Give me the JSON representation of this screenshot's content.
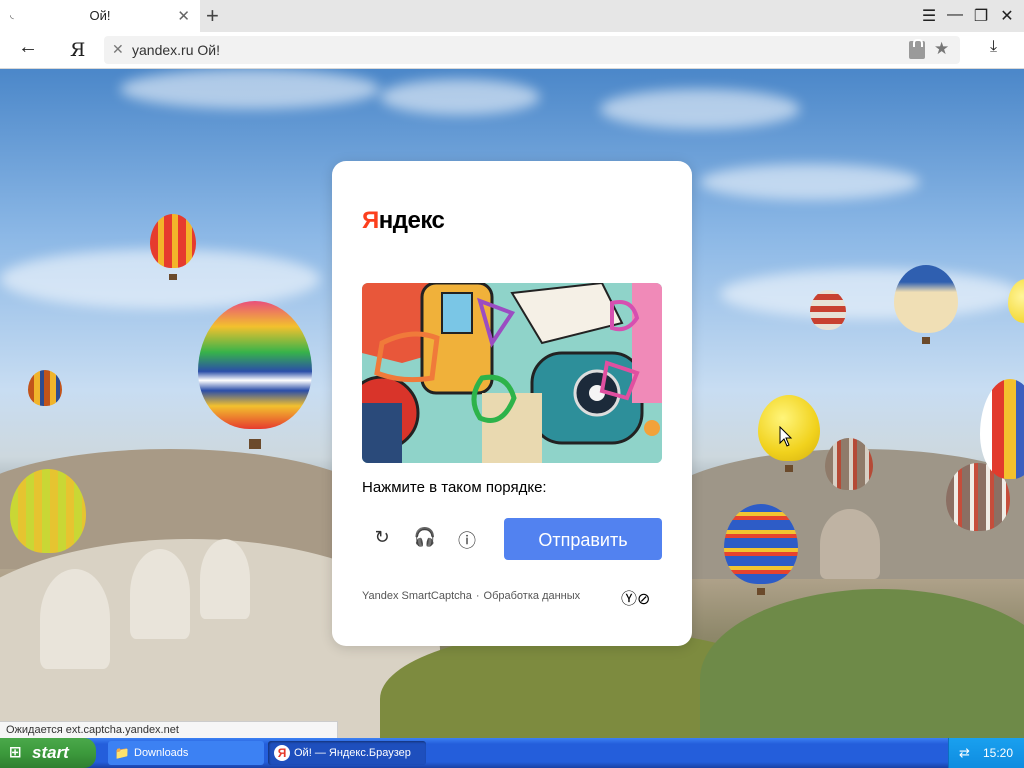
{
  "browser": {
    "tab_title": "Ой!",
    "tab_close_icon": "✕",
    "new_tab_icon": "+",
    "menu_icon": "☰",
    "minimize_icon": "—",
    "restore_icon": "❐",
    "close_icon": "✕",
    "back_icon": "←",
    "home_icon": "Я",
    "address": "yandex.ru Ой!",
    "clear_icon": "✕",
    "bookmark_icon": "★",
    "download_icon": "⤓"
  },
  "captcha": {
    "logo_first": "Я",
    "logo_rest": "ндекс",
    "task_text": "Нажмите в таком порядке:",
    "refresh_icon": "↻",
    "audio_icon": "🎧",
    "info_icon": "ⓘ",
    "submit_label": "Отправить",
    "footer_brand": "Yandex SmartCaptcha",
    "footer_separator": "·",
    "footer_link": "Обработка данных",
    "brand_logo": "Ⓨ⊘"
  },
  "status": {
    "text": "Ожидается ext.captcha.yandex.net"
  },
  "taskbar": {
    "start_label": "start",
    "start_icon": "⊞",
    "items": [
      {
        "label": "Downloads",
        "icon": "📁"
      },
      {
        "label": "Ой! — Яндекс.Браузер",
        "icon": "Я"
      }
    ],
    "tray_icon": "⇄",
    "clock": "15:20"
  },
  "colors": {
    "yandex_red": "#fc3f1d",
    "submit_blue": "#5282f0",
    "taskbar_blue": "#245edb",
    "start_green": "#3c9a3c"
  }
}
